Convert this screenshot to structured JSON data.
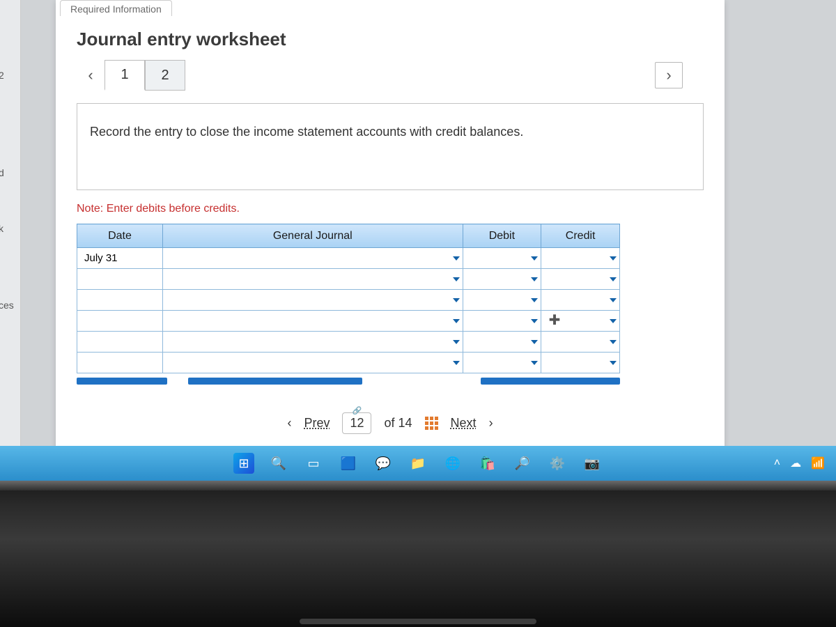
{
  "leftRail": {
    "frag1": "2",
    "frag2": "d",
    "frag3": "k",
    "frag4": "ces"
  },
  "reqTab": "Required Information",
  "title": "Journal entry worksheet",
  "nav": {
    "prevSym": "‹",
    "nextSym": "›"
  },
  "steps": [
    "1",
    "2"
  ],
  "activeStep": 0,
  "instruction": "Record the entry to close the income statement accounts with credit balances.",
  "note": "Note: Enter debits before credits.",
  "columns": {
    "date": "Date",
    "gj": "General Journal",
    "debit": "Debit",
    "credit": "Credit"
  },
  "rows": [
    {
      "date": "July 31",
      "gj": "",
      "debit": "",
      "credit": ""
    },
    {
      "date": "",
      "gj": "",
      "debit": "",
      "credit": ""
    },
    {
      "date": "",
      "gj": "",
      "debit": "",
      "credit": ""
    },
    {
      "date": "",
      "gj": "",
      "debit": "",
      "credit": ""
    },
    {
      "date": "",
      "gj": "",
      "debit": "",
      "credit": ""
    },
    {
      "date": "",
      "gj": "",
      "debit": "",
      "credit": ""
    }
  ],
  "pager": {
    "prev": "Prev",
    "current": "12",
    "ofWord": "of",
    "total": "14",
    "next": "Next"
  },
  "taskbarIcons": [
    "start",
    "search",
    "taskview",
    "widgets",
    "chat",
    "explorer",
    "edge",
    "store",
    "magnify",
    "settings",
    "camera"
  ]
}
